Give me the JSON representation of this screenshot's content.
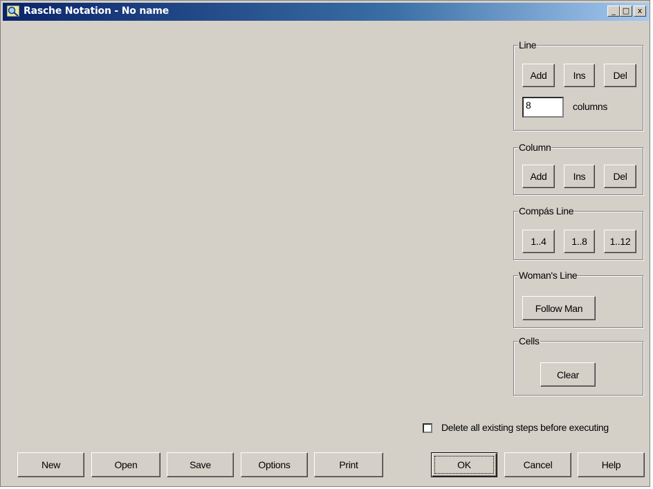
{
  "window": {
    "title": "Rasche Notation - No name",
    "controls": {
      "minimize": "_",
      "maximize": "□",
      "close": "x"
    }
  },
  "line_group": {
    "legend": "Line",
    "add": "Add",
    "ins": "Ins",
    "del": "Del",
    "columns_value": "8",
    "columns_label": "columns"
  },
  "column_group": {
    "legend": "Column",
    "add": "Add",
    "ins": "Ins",
    "del": "Del"
  },
  "compas_group": {
    "legend": "Compás Line",
    "b1": "1..4",
    "b2": "1..8",
    "b3": "1..12"
  },
  "womans_group": {
    "legend": "Woman's Line",
    "follow": "Follow Man"
  },
  "cells_group": {
    "legend": "Cells",
    "clear": "Clear"
  },
  "options": {
    "delete_steps_label": "Delete all existing steps before executing",
    "delete_steps_checked": false
  },
  "bottom": {
    "new": "New",
    "open": "Open",
    "save": "Save",
    "options": "Options",
    "print": "Print",
    "ok": "OK",
    "cancel": "Cancel",
    "help": "Help"
  }
}
